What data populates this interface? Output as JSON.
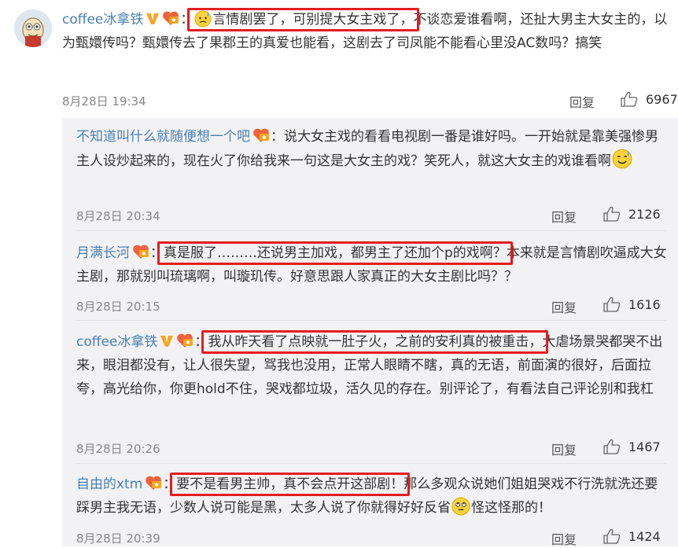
{
  "main_comment": {
    "username": "coffee冰拿铁",
    "sep": "：",
    "highlight": "言情剧罢了，可别提大女主戏了，",
    "body": "不谈恋爱谁看啊，还扯大男主大女主的，以为甄嬛传吗？甄嬛传去了果郡王的真爱也能看，这剧去了司凤能不能看心里没AC数吗？搞笑",
    "time": "8月28日 19:34",
    "reply_label": "回复",
    "likes": "6967"
  },
  "replies": [
    {
      "username": "不知道叫什么就随便想一个吧",
      "sep": "：",
      "pre": "",
      "highlight": "",
      "body": "说大女主戏的看看电视剧一番是谁好吗。一开始就是靠美强惨男主人设炒起来的，现在火了你给我来一句这是大女主的戏？笑死人，就这大女主的戏谁看啊",
      "time": "8月28日 20:34",
      "reply_label": "回复",
      "likes": "2126"
    },
    {
      "username": "月满长河",
      "sep": "：",
      "pre": "",
      "highlight": "真是服了………还说男主加戏，都男主了还加个p的戏啊？",
      "body": "本来就是言情剧吹逼成大女主剧，那就别叫琉璃啊，叫璇玑传。好意思跟人家真正的大女主剧比吗？？",
      "time": "8月28日 20:15",
      "reply_label": "回复",
      "likes": "1616"
    },
    {
      "username": "coffee冰拿铁",
      "sep": "：",
      "pre": "",
      "highlight": "我从昨天看了点映就一肚子火，之前的安利真的被重击，",
      "body": "大虐场景哭都哭不出来，眼泪都没有，让人很失望，骂我也没用，正常人眼睛不瞎，真的无语，前面演的很好，后面拉夸，高光给你，你更hold不住，哭戏都垃圾，活久见的存在。别评论了，有看法自己评论别和我杠",
      "time": "8月28日 20:26",
      "reply_label": "回复",
      "likes": "1467"
    },
    {
      "username": "自由的xtm",
      "sep": "：",
      "pre": "",
      "highlight": "要不是看男主帅，真不会点开这部剧！",
      "body": "那么多观众说她们姐姐哭戏不行洗就洗还要踩男主我无语，少数人说可能是黑，太多人说了你就得好好反省",
      "tail": "怪这怪那的！",
      "time": "8月28日 20:39",
      "reply_label": "回复",
      "likes": "1424"
    }
  ],
  "colors": {
    "username": "#4a7fb0",
    "highlight_box": "#e41d1d",
    "reply_panel_bg": "#f2f2f5",
    "badge_gold": "#f5a623"
  },
  "icons": [
    "avatar-cartoon",
    "verified-v-icon",
    "fan-medal-icon",
    "sweat-emoji-icon",
    "sweat-smile-emoji-icon",
    "eye-roll-emoji-icon",
    "thumbs-up-icon"
  ]
}
